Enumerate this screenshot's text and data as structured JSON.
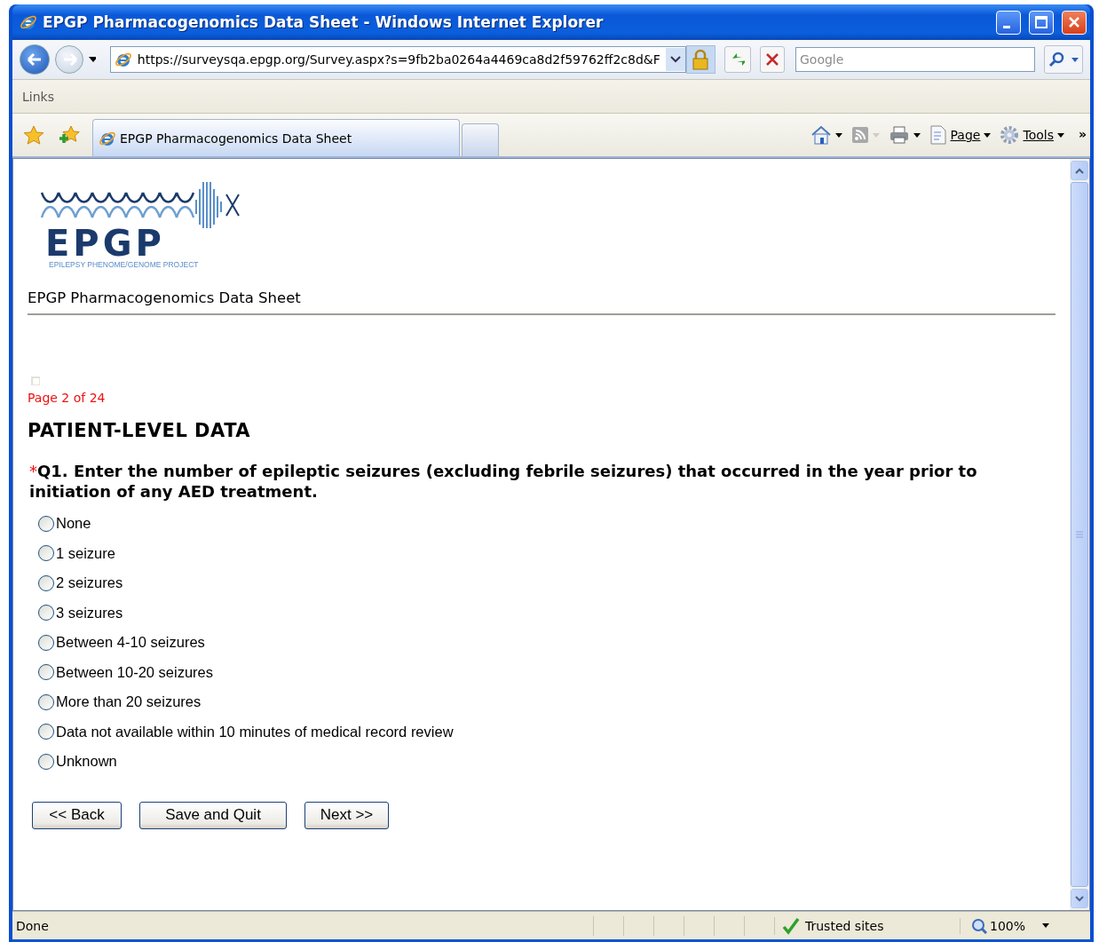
{
  "window": {
    "title": "EPGP Pharmacogenomics Data Sheet - Windows Internet Explorer"
  },
  "address_bar": {
    "url": "https://surveysqa.epgp.org/Survey.aspx?s=9fb2ba0264a4469ca8d2f59762ff2c8d&F"
  },
  "search": {
    "placeholder": "Google"
  },
  "links_bar": {
    "label": "Links"
  },
  "tabs": [
    {
      "label": "EPGP Pharmacogenomics Data Sheet",
      "selected": true
    }
  ],
  "command_bar": {
    "items": [
      {
        "kind": "home"
      },
      {
        "kind": "feeds"
      },
      {
        "kind": "print"
      },
      {
        "kind": "page",
        "label": "Page"
      },
      {
        "kind": "tools",
        "label": "Tools"
      }
    ],
    "overflow": "»"
  },
  "page": {
    "logo": {
      "wordmark": "EPGP",
      "tagline": "EPILEPSY PHENOME/GENOME PROJECT"
    },
    "heading": "EPGP Pharmacogenomics Data Sheet",
    "progress": "Page 2 of 24",
    "section": "PATIENT-LEVEL DATA",
    "question": {
      "required_mark": "*",
      "text": "Q1. Enter the number of epileptic seizures (excluding febrile seizures) that occurred in the year prior to initiation of any AED treatment.",
      "options": [
        {
          "label": "None",
          "selected": false
        },
        {
          "label": "1 seizure",
          "selected": false
        },
        {
          "label": "2 seizures",
          "selected": false
        },
        {
          "label": "3 seizures",
          "selected": false
        },
        {
          "label": "Between 4-10 seizures",
          "selected": false
        },
        {
          "label": "Between 10-20 seizures",
          "selected": false
        },
        {
          "label": "More than 20 seizures",
          "selected": false
        },
        {
          "label": "Data not available within 10 minutes of medical record review",
          "selected": false
        },
        {
          "label": "Unknown",
          "selected": false
        }
      ]
    },
    "buttons": [
      "<< Back",
      "Save and Quit",
      "Next >>"
    ]
  },
  "status_bar": {
    "text": "Done",
    "zone": "Trusted sites",
    "zoom": "100%"
  }
}
